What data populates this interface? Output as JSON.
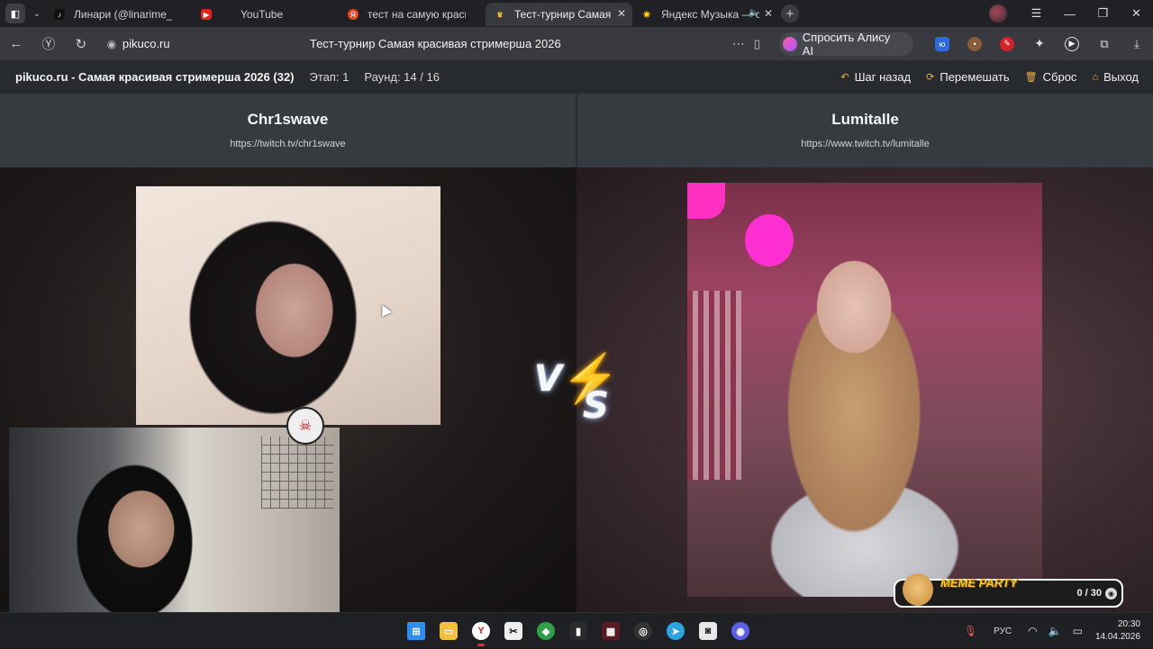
{
  "browser": {
    "tabs": [
      {
        "label": "Линари (@linarime_) | TikTok",
        "favicon": "tiktok-icon",
        "active": false
      },
      {
        "label": "YouTube",
        "favicon": "youtube-icon",
        "active": false
      },
      {
        "label": "тест на самую красивую стримершу",
        "favicon": "yandex-icon",
        "active": false
      },
      {
        "label": "Тест-турнир Самая красивая стримерша",
        "favicon": "crown-icon",
        "active": true
      },
      {
        "label": "Яндекс Музыка — собираем музыку",
        "favicon": "yandex-music-icon",
        "active": false
      }
    ],
    "address": {
      "host": "pikuco.ru",
      "page_title": "Тест-турнир Самая красивая стримерша 2026"
    },
    "alice_button": "Спросить Алису AI"
  },
  "site": {
    "title": "pikuco.ru - Самая красивая стримерша 2026 (32)",
    "stage": "Этап: 1",
    "round": "Раунд: 14 / 16",
    "actions": {
      "back": "Шаг назад",
      "shuffle": "Перемешать",
      "reset": "Сброс",
      "exit": "Выход"
    },
    "accent": "#f2b23a"
  },
  "contestants": {
    "left": {
      "name": "Chr1swave",
      "link": "https://twitch.tv/chr1swave"
    },
    "right": {
      "name": "Lumitalle",
      "link": "https://www.twitch.tv/lumitalle"
    }
  },
  "vs": {
    "v": "V",
    "s": "S"
  },
  "meme_party": {
    "title": "MEME PARTY",
    "count": "0 / 30"
  },
  "taskbar": {
    "language": "РУС",
    "time": "20:30",
    "date": "14.04.2026"
  }
}
